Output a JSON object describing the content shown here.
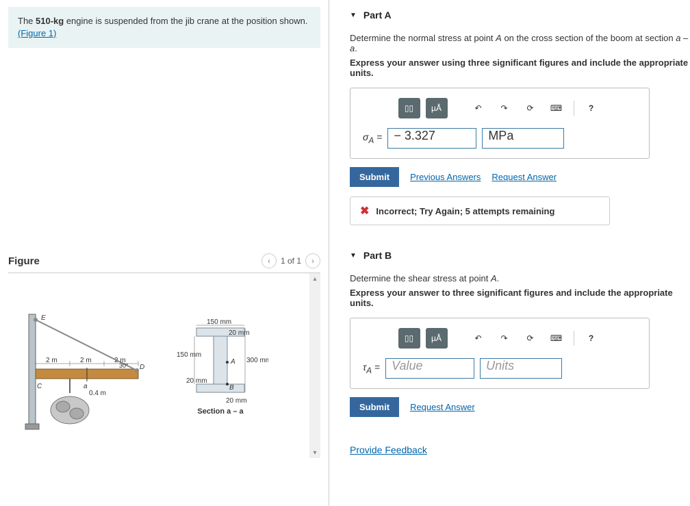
{
  "problem": {
    "text_prefix": "The ",
    "mass": "510-kg",
    "text_suffix": " engine is suspended from the jib crane at the position shown.",
    "figure_link": "(Figure 1)"
  },
  "figure": {
    "title": "Figure",
    "pager": "1 of 1",
    "crane": {
      "E": "E",
      "D": "D",
      "C": "C",
      "a": "a",
      "seg1": "2 m",
      "seg2": "2 m",
      "seg3": "2 m",
      "angle": "30°",
      "drop": "0.4 m"
    },
    "section": {
      "top_w": "150 mm",
      "top_t": "20 mm",
      "web_h": "150 mm",
      "web_t": "20 mm",
      "A": "A",
      "B": "B",
      "depth": "300 mm",
      "bot_t": "20 mm",
      "caption": "Section a – a"
    }
  },
  "partA": {
    "title": "Part A",
    "desc_prefix": "Determine the normal stress at point ",
    "desc_pt": "A",
    "desc_mid": " on the cross section of the boom at section ",
    "desc_sec": "a – a",
    "desc_end": ".",
    "instr": "Express your answer using three significant figures and include the appropriate units.",
    "lhs": "σ",
    "sub": "A",
    "eq": "=",
    "value": "− 3.327",
    "units": "MPa",
    "submit": "Submit",
    "prev": "Previous Answers",
    "req": "Request Answer",
    "feedback": "Incorrect; Try Again; 5 attempts remaining"
  },
  "partB": {
    "title": "Part B",
    "desc_prefix": "Determine the shear stress at point ",
    "desc_pt": "A",
    "desc_end": ".",
    "instr": "Express your answer to three significant figures and include the appropriate units.",
    "lhs": "τ",
    "sub": "A",
    "eq": "=",
    "value_ph": "Value",
    "units_ph": "Units",
    "submit": "Submit",
    "req": "Request Answer"
  },
  "toolbar": {
    "templates": "▯▯",
    "greek": "µÅ",
    "undo": "↶",
    "redo": "↷",
    "reset": "⟳",
    "keyboard": "⌨",
    "help": "?"
  },
  "feedback_link": "Provide Feedback"
}
